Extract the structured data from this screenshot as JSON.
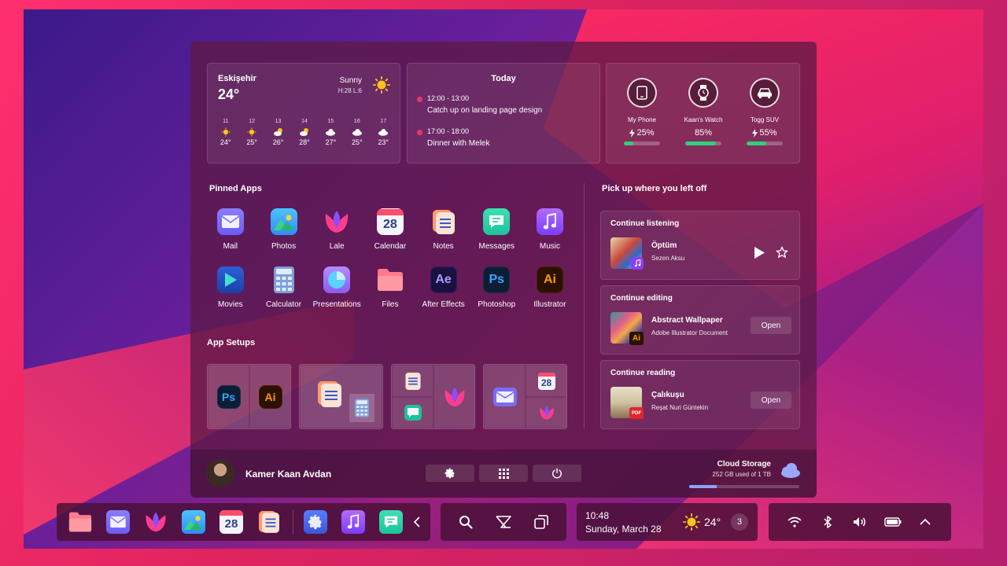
{
  "weather": {
    "city": "Eskişehir",
    "temp": "24°",
    "condition": "Sunny",
    "hilo": "H:28 L:6",
    "forecast": [
      {
        "day": "11",
        "icon": "sun-icon",
        "temp": "24°"
      },
      {
        "day": "12",
        "icon": "sun-icon",
        "temp": "25°"
      },
      {
        "day": "13",
        "icon": "partly-cloudy-icon",
        "temp": "26°"
      },
      {
        "day": "14",
        "icon": "partly-cloudy-icon",
        "temp": "28°"
      },
      {
        "day": "15",
        "icon": "cloud-icon",
        "temp": "27°"
      },
      {
        "day": "16",
        "icon": "cloud-icon",
        "temp": "25°"
      },
      {
        "day": "17",
        "icon": "cloud-icon",
        "temp": "23°"
      }
    ]
  },
  "today": {
    "title": "Today",
    "events": [
      {
        "time": "12:00 - 13:00",
        "title": "Catch up on landing page design"
      },
      {
        "time": "17:00 - 18:00",
        "title": "Dinner with Melek"
      }
    ]
  },
  "devices": [
    {
      "name": "My Phone",
      "percent_label": "25%",
      "level": 0.25,
      "charging": true,
      "icon": "phone-icon"
    },
    {
      "name": "Kaan's Watch",
      "percent_label": "85%",
      "level": 0.85,
      "charging": false,
      "icon": "watch-icon"
    },
    {
      "name": "Togg SUV",
      "percent_label": "55%",
      "level": 0.55,
      "charging": true,
      "icon": "car-icon"
    }
  ],
  "pinned": {
    "title": "Pinned Apps",
    "apps": [
      {
        "label": "Mail",
        "icon": "mail-icon"
      },
      {
        "label": "Photos",
        "icon": "photos-icon"
      },
      {
        "label": "Lale",
        "icon": "lale-icon"
      },
      {
        "label": "Calendar",
        "icon": "calendar-icon",
        "badge": "28"
      },
      {
        "label": "Notes",
        "icon": "notes-icon"
      },
      {
        "label": "Messages",
        "icon": "messages-icon"
      },
      {
        "label": "Music",
        "icon": "music-icon"
      },
      {
        "label": "Movies",
        "icon": "movies-icon"
      },
      {
        "label": "Calculator",
        "icon": "calculator-icon"
      },
      {
        "label": "Presentations",
        "icon": "presentations-icon"
      },
      {
        "label": "Files",
        "icon": "files-icon"
      },
      {
        "label": "After Effects",
        "icon": "after-effects-icon",
        "badge": "Ae"
      },
      {
        "label": "Photoshop",
        "icon": "photoshop-icon",
        "badge": "Ps"
      },
      {
        "label": "Illustrator",
        "icon": "illustrator-icon",
        "badge": "Ai"
      }
    ]
  },
  "setups": {
    "title": "App Setups",
    "ps": "Ps",
    "ai": "Ai",
    "cal": "28"
  },
  "pickup": {
    "title": "Pick up where you left off",
    "listening": {
      "heading": "Continue listening",
      "title": "Öptüm",
      "subtitle": "Sezen Aksu"
    },
    "editing": {
      "heading": "Continue editing",
      "title": "Abstract Wallpaper",
      "subtitle": "Adobe Illustrator Document",
      "open": "Open",
      "badge": "Ai"
    },
    "reading": {
      "heading": "Continue reading",
      "title": "Çalıkuşu",
      "subtitle": "Reşat Nuri Güntekin",
      "open": "Open",
      "badge": "PDF"
    }
  },
  "user": {
    "name": "Kamer Kaan Avdan"
  },
  "cloud": {
    "title": "Cloud Storage",
    "usage": "252 GB used of 1 TB",
    "level": 0.25
  },
  "taskbar": {
    "time": "10:48",
    "date": "Sunday, March 28",
    "temp": "24°",
    "notifications": "3",
    "calendar_badge": "28"
  },
  "colors": {
    "accent": "#2fd07a",
    "event_dot": "#e8356b",
    "cloud": "#8fa0ff"
  }
}
